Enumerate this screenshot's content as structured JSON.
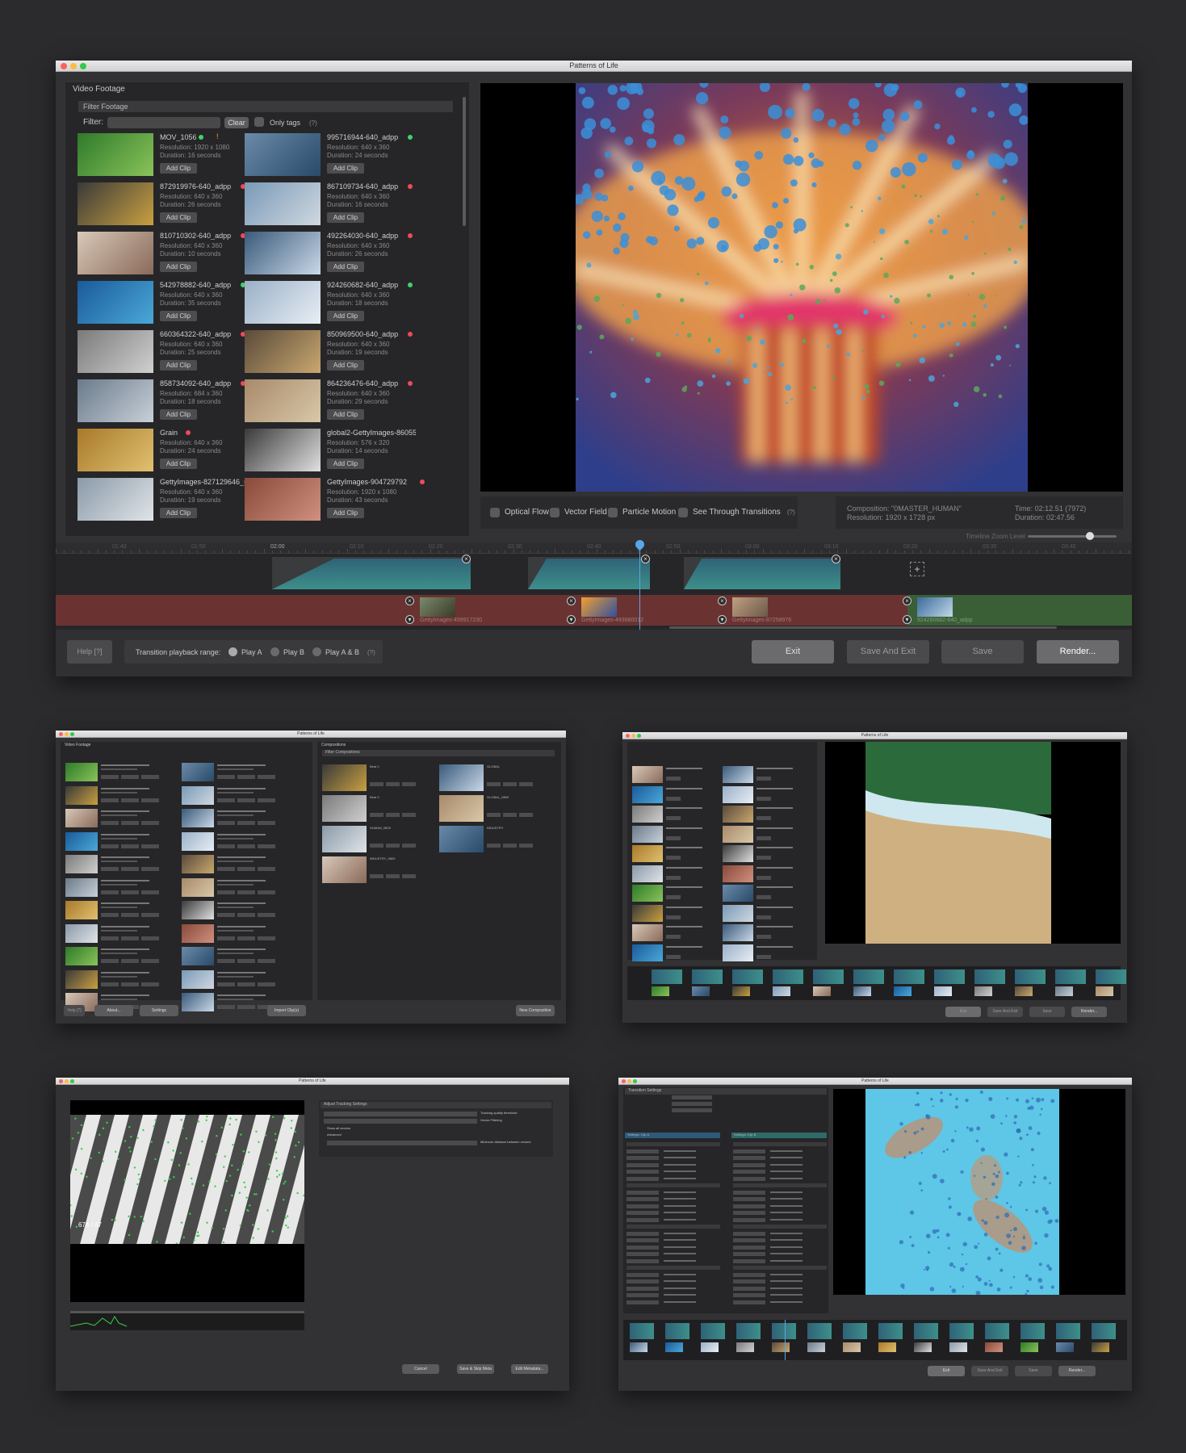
{
  "window": {
    "title": "Patterns of Life"
  },
  "footage": {
    "section_title": "Video Footage",
    "filter_title": "Filter Footage",
    "filter_label": "Filter:",
    "clear_label": "Clear",
    "only_tags_label": "Only tags",
    "help_hint": "(?)",
    "add_clip_label": "Add Clip",
    "items": [
      {
        "name": "MOV_1056",
        "status": "green",
        "flag": "!",
        "resolution": "Resolution: 1920 x 1080",
        "duration": "Duration: 16 seconds"
      },
      {
        "name": "995716944-640_adpp",
        "status": "green",
        "resolution": "Resolution: 640 x 360",
        "duration": "Duration: 24 seconds"
      },
      {
        "name": "872919976-640_adpp",
        "status": "red",
        "resolution": "Resolution: 640 x 360",
        "duration": "Duration: 26 seconds"
      },
      {
        "name": "867109734-640_adpp",
        "status": "red",
        "resolution": "Resolution: 640 x 360",
        "duration": "Duration: 16 seconds"
      },
      {
        "name": "810710302-640_adpp",
        "status": "red",
        "resolution": "Resolution: 640 x 360",
        "duration": "Duration: 10 seconds"
      },
      {
        "name": "492264030-640_adpp",
        "status": "red",
        "resolution": "Resolution: 640 x 360",
        "duration": "Duration: 26 seconds"
      },
      {
        "name": "542978882-640_adpp",
        "status": "green",
        "resolution": "Resolution: 640 x 360",
        "duration": "Duration: 35 seconds"
      },
      {
        "name": "924260682-640_adpp",
        "status": "green",
        "resolution": "Resolution: 640 x 360",
        "duration": "Duration: 18 seconds"
      },
      {
        "name": "660364322-640_adpp",
        "status": "red",
        "resolution": "Resolution: 640 x 360",
        "duration": "Duration: 25 seconds"
      },
      {
        "name": "850969500-640_adpp",
        "status": "red",
        "resolution": "Resolution: 640 x 360",
        "duration": "Duration: 19 seconds"
      },
      {
        "name": "858734092-640_adpp",
        "status": "red",
        "resolution": "Resolution: 684 x 360",
        "duration": "Duration: 18 seconds"
      },
      {
        "name": "864236476-640_adpp",
        "status": "red",
        "resolution": "Resolution: 640 x 360",
        "duration": "Duration: 29 seconds"
      },
      {
        "name": "Grain",
        "status": "red",
        "resolution": "Resolution: 640 x 360",
        "duration": "Duration: 24 seconds"
      },
      {
        "name": "global2-GettyImages-86055414",
        "status": "",
        "resolution": "Resolution: 576 x 320",
        "duration": "Duration: 14 seconds"
      },
      {
        "name": "GettyImages-827129646_stabl",
        "status": "",
        "resolution": "Resolution: 640 x 360",
        "duration": "Duration: 19 seconds"
      },
      {
        "name": "GettyImages-904729792",
        "status": "red",
        "resolution": "Resolution: 1920 x 1080",
        "duration": "Duration: 43 seconds"
      }
    ]
  },
  "preview": {
    "options": [
      "Optical Flow",
      "Vector Field",
      "Particle Motion",
      "See Through Transitions"
    ],
    "help_hint": "(?)",
    "composition": "Composition: \"0MASTER_HUMAN\"",
    "resolution": "Resolution: 1920 x 1728 px",
    "time": "Time: 02:12.51 (7972)",
    "duration": "Duration: 02:47.56",
    "zoom_label": "Timeline Zoom Level",
    "zoom_level": 0.7
  },
  "timeline": {
    "ticks": [
      "01:40",
      "01:50",
      "02:00",
      "02:10",
      "02:20",
      "02:30",
      "02:40",
      "02:50",
      "03:00",
      "03:10",
      "03:20",
      "03:30",
      "03:40"
    ],
    "highlight_tick": "02:00",
    "clips": [
      "GettyImages-459917230",
      "GettyImages-493880012",
      "GettyImages-87258976",
      "924260682-640_adpp"
    ],
    "add_icon": "+"
  },
  "footer": {
    "help": "Help [?]",
    "range_label": "Transition playback range:",
    "play_a": "Play A",
    "play_b": "Play B",
    "play_ab": "Play A & B",
    "help_hint": "(?)",
    "exit": "Exit",
    "save_exit": "Save And Exit",
    "save": "Save",
    "render": "Render..."
  },
  "mini": {
    "title": "Patterns of Life",
    "w2": {
      "left_title": "Video Footage",
      "right_title": "Compositions",
      "filter_comp": "Filter Compositions",
      "buttons": [
        "Help [?]",
        "About...",
        "Settings",
        "Import Clip(s)",
        "New Composition"
      ],
      "comps": [
        "Beta 2",
        "GLOBAL",
        "Beta 3",
        "GLOBAL_0809",
        "HUMAN_0809",
        "INDUSTRY",
        "INDUSTRY_0809"
      ]
    },
    "w3": {
      "buttons": [
        "Exit",
        "Save And Exit",
        "Save",
        "Render..."
      ]
    },
    "w4": {
      "section": "Adjust Tracking Settings",
      "rows": [
        "Tracking quality threshold",
        "Vector Filtering",
        "Show all vectors",
        "Advanced",
        "Minimum distance between vectors"
      ],
      "counter": "674 / 47",
      "buttons": [
        "Cancel",
        "Save & Skip Meta",
        "Edit Metadata..."
      ]
    },
    "w5": {
      "section": "Transition Settings",
      "clip_a": "Settings: Clip A",
      "clip_b": "Settings: Clip B",
      "buttons": [
        "Exit",
        "Save And Exit",
        "Save",
        "Render..."
      ]
    }
  },
  "colors": {
    "accent_blue": "#5aa7e6",
    "status_green": "#3fd26e",
    "status_red": "#f04a5a",
    "timeline_red": "#6b3232",
    "timeline_green": "#3a5f36"
  }
}
